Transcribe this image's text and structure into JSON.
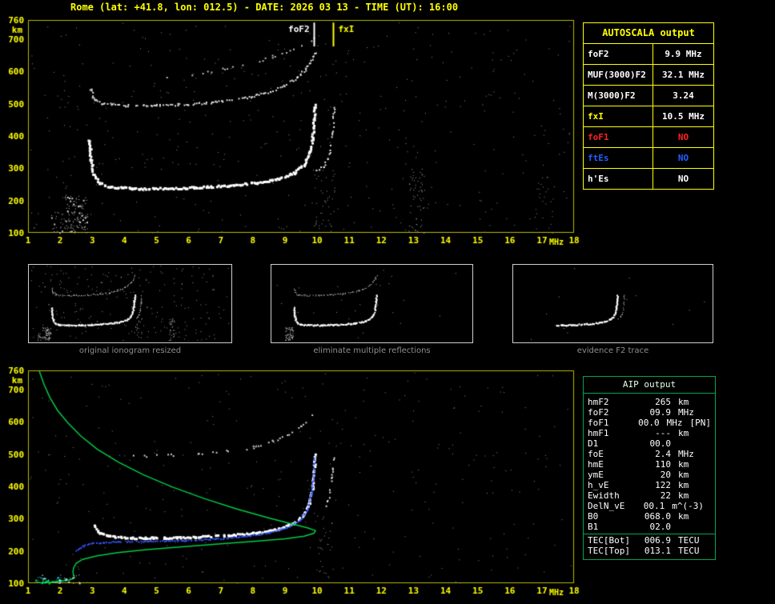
{
  "header": {
    "title": "Rome (lat: +41.8, lon: 012.5) - DATE: 2026 03 13 - TIME (UT): 16:00"
  },
  "colors": {
    "background": "#000000",
    "accent_yellow": "#ffff00",
    "aip_green": "#00a550",
    "status_no_red": "#ff2020",
    "status_no_blue": "#2060ff",
    "trace_white": "#ffffff",
    "calc_trace_blue": "#3355ff",
    "profile_green": "#00cc44"
  },
  "autoscala": {
    "title": "AUTOSCALA output",
    "rows": [
      {
        "label": "foF2",
        "value": "9.9 MHz",
        "label_color": "#ffffff",
        "value_color": "#ffffff"
      },
      {
        "label": "MUF(3000)F2",
        "value": "32.1 MHz",
        "label_color": "#ffffff",
        "value_color": "#ffffff"
      },
      {
        "label": "M(3000)F2",
        "value": "3.24",
        "label_color": "#ffffff",
        "value_color": "#ffffff"
      },
      {
        "label": "fxI",
        "value": "10.5 MHz",
        "label_color": "#ffff00",
        "value_color": "#ffffff"
      },
      {
        "label": "foF1",
        "value": "NO",
        "label_color": "#ff2020",
        "value_color": "#ff2020"
      },
      {
        "label": "ftEs",
        "value": "NO",
        "label_color": "#2060ff",
        "value_color": "#2060ff"
      },
      {
        "label": "h'Es",
        "value": "NO",
        "label_color": "#ffffff",
        "value_color": "#ffffff"
      }
    ]
  },
  "aip": {
    "title": "AIP output",
    "rows": [
      {
        "label": "hmF2",
        "value": "265",
        "unit": "km"
      },
      {
        "label": "foF2",
        "value": "09.9",
        "unit": "MHz"
      },
      {
        "label": "foF1",
        "value": "00.0",
        "unit": "MHz",
        "note": "[PN]"
      },
      {
        "label": "hmF1",
        "value": "---",
        "unit": "km"
      },
      {
        "label": "D1",
        "value": "00.0",
        "unit": ""
      },
      {
        "label": "foE",
        "value": "2.4",
        "unit": "MHz"
      },
      {
        "label": "hmE",
        "value": "110",
        "unit": "km"
      },
      {
        "label": "ymE",
        "value": "20",
        "unit": "km"
      },
      {
        "label": "h_vE",
        "value": "122",
        "unit": "km"
      },
      {
        "label": "Ewidth",
        "value": "22",
        "unit": "km"
      },
      {
        "label": "DelN_vE",
        "value": "00.1",
        "unit": "m^(-3)"
      },
      {
        "label": "B0",
        "value": "068.0",
        "unit": "km"
      },
      {
        "label": "B1",
        "value": "02.0",
        "unit": ""
      },
      {
        "label": "TEC[Bot]",
        "value": "006.9",
        "unit": "TECU"
      },
      {
        "label": "TEC[Top]",
        "value": "013.1",
        "unit": "TECU"
      }
    ]
  },
  "thumbnails": [
    {
      "caption": "original ionogram resized",
      "refs": [
        "f2_trace",
        "f2_cusp_x",
        "multiple_trace",
        "second_multiple",
        "e_region_scatter",
        "e_region_scatter2",
        "noise_floor",
        "noise_band_13",
        "noise_band_10"
      ]
    },
    {
      "caption": "eliminate multiple reflections",
      "refs": [
        "f2_trace",
        "multiple_trace",
        "e_region_scatter"
      ],
      "noise": 60
    },
    {
      "caption": "evidence F2 trace",
      "refs": [
        {
          "ref": "f2_trace",
          "clip": [
            4.6,
            10.2
          ]
        },
        "f2_cusp_x"
      ],
      "noise": 24
    }
  ],
  "chart_data": [
    {
      "id": "autoscala_ionogram",
      "type": "scatter",
      "title": "",
      "xlabel": "MHz",
      "ylabel": "km",
      "xlim": [
        1,
        18
      ],
      "ylim": [
        100,
        760
      ],
      "xticks": [
        1,
        2,
        3,
        4,
        5,
        6,
        7,
        8,
        9,
        10,
        11,
        12,
        13,
        14,
        15,
        16,
        17,
        18
      ],
      "yticks": [
        100,
        200,
        300,
        400,
        500,
        600,
        700,
        760
      ],
      "axis_color": "#ffff00",
      "frame_color": "#b8b800",
      "grid": false,
      "legend": "none",
      "series": [
        {
          "name": "f2_trace",
          "style": "dots",
          "color": "#ffffff",
          "size": 3,
          "spacing": 2,
          "density": 0.92,
          "jitter": 1.2,
          "points": [
            [
              2.88,
              392
            ],
            [
              2.93,
              330
            ],
            [
              3.02,
              284
            ],
            [
              3.18,
              258
            ],
            [
              3.5,
              246
            ],
            [
              4.2,
              240
            ],
            [
              5.2,
              240
            ],
            [
              6.2,
              243
            ],
            [
              7.2,
              249
            ],
            [
              8.1,
              258
            ],
            [
              8.8,
              270
            ],
            [
              9.25,
              288
            ],
            [
              9.55,
              313
            ],
            [
              9.73,
              348
            ],
            [
              9.83,
              398
            ],
            [
              9.88,
              452
            ],
            [
              9.91,
              500
            ]
          ]
        },
        {
          "name": "f2_cusp_x",
          "style": "dots",
          "color": "#e8e8e8",
          "size": 2,
          "spacing": 2.5,
          "density": 0.7,
          "jitter": 1,
          "points": [
            [
              9.98,
              295
            ],
            [
              10.18,
              308
            ],
            [
              10.32,
              332
            ],
            [
              10.42,
              372
            ],
            [
              10.48,
              432
            ],
            [
              10.51,
              497
            ]
          ]
        },
        {
          "name": "multiple_trace",
          "style": "dots",
          "color": "#dddddd",
          "size": 2,
          "spacing": 2.2,
          "density": 0.8,
          "jitter": 1.4,
          "points": [
            [
              2.92,
              556
            ],
            [
              3.02,
              518
            ],
            [
              3.25,
              502
            ],
            [
              4.0,
              496
            ],
            [
              5.0,
              497
            ],
            [
              6.0,
              501
            ],
            [
              7.0,
              509
            ],
            [
              7.8,
              521
            ],
            [
              8.45,
              538
            ],
            [
              8.95,
              558
            ],
            [
              9.35,
              582
            ],
            [
              9.65,
              612
            ],
            [
              9.85,
              645
            ],
            [
              9.98,
              668
            ]
          ]
        },
        {
          "name": "second_multiple",
          "style": "dots",
          "color": "#bbbbbb",
          "size": 2,
          "spacing": 3,
          "density": 0.3,
          "jitter": 2,
          "points": [
            [
              5.3,
              585
            ],
            [
              6.3,
              596
            ],
            [
              7.3,
              612
            ],
            [
              8.2,
              634
            ],
            [
              9.0,
              660
            ],
            [
              9.6,
              688
            ],
            [
              10.0,
              710
            ]
          ]
        },
        {
          "name": "e_region_scatter",
          "style": "speckle",
          "color": "#cccccc",
          "size": 2,
          "count": 110,
          "x": [
            2.15,
            2.85
          ],
          "y": [
            100,
            218
          ]
        },
        {
          "name": "e_region_scatter2",
          "style": "speckle",
          "color": "#aaaaaa",
          "size": 2,
          "count": 30,
          "x": [
            1.7,
            2.2
          ],
          "y": [
            100,
            165
          ]
        },
        {
          "name": "noise_floor",
          "style": "speckle",
          "color": "#909090",
          "size": 1,
          "count": 420,
          "x": [
            1.05,
            17.9
          ],
          "y": [
            100,
            755
          ]
        },
        {
          "name": "noise_band_13",
          "style": "speckle",
          "color": "#aaaaaa",
          "size": 1,
          "count": 60,
          "x": [
            12.85,
            13.35
          ],
          "y": [
            100,
            300
          ]
        },
        {
          "name": "noise_band_10",
          "style": "speckle",
          "color": "#999999",
          "size": 1,
          "count": 40,
          "x": [
            9.85,
            10.55
          ],
          "y": [
            100,
            300
          ]
        },
        {
          "name": "noise_band_17",
          "style": "speckle",
          "color": "#888888",
          "size": 1,
          "count": 22,
          "x": [
            16.8,
            17.4
          ],
          "y": [
            100,
            280
          ]
        }
      ],
      "markers": [
        {
          "label": "foF2",
          "x": 9.9,
          "color": "#ffffff",
          "label_side": "left",
          "h_from": 752,
          "h_to": 678
        },
        {
          "label": "fxI",
          "x": 10.5,
          "color": "#ffff00",
          "label_side": "right",
          "h_from": 752,
          "h_to": 678
        }
      ]
    },
    {
      "id": "aip_ionogram",
      "type": "scatter",
      "title": "",
      "xlabel": "MHz",
      "ylabel": "km",
      "xlim": [
        1,
        18
      ],
      "ylim": [
        100,
        760
      ],
      "xticks": [
        1,
        2,
        3,
        4,
        5,
        6,
        7,
        8,
        9,
        10,
        11,
        12,
        13,
        14,
        15,
        16,
        17,
        18
      ],
      "yticks": [
        100,
        200,
        300,
        400,
        500,
        600,
        700,
        760
      ],
      "axis_color": "#ffff00",
      "frame_color": "#b8b800",
      "grid": false,
      "legend": "none",
      "series": [
        {
          "name": "restored_trace",
          "style": "dots",
          "color": "#ffffff",
          "size": 3,
          "spacing": 2,
          "density": 0.9,
          "jitter": 1,
          "points": [
            [
              3.05,
              280
            ],
            [
              3.2,
              258
            ],
            [
              3.5,
              248
            ],
            [
              4.2,
              243
            ],
            [
              5.2,
              243
            ],
            [
              6.2,
              246
            ],
            [
              7.2,
              251
            ],
            [
              8.1,
              259
            ],
            [
              8.8,
              271
            ],
            [
              9.25,
              289
            ],
            [
              9.55,
              314
            ],
            [
              9.73,
              349
            ],
            [
              9.83,
              399
            ],
            [
              9.88,
              452
            ],
            [
              9.91,
              500
            ]
          ]
        },
        {
          "name": "xmode_cusp",
          "style": "dots",
          "color": "#dddddd",
          "size": 2,
          "spacing": 2.5,
          "density": 0.6,
          "jitter": 1,
          "points": [
            [
              10.2,
              330
            ],
            [
              10.35,
              365
            ],
            [
              10.44,
              420
            ],
            [
              10.5,
              492
            ]
          ]
        },
        {
          "name": "calc_trace_blue",
          "style": "dots",
          "color": "#3355ff",
          "size": 2,
          "spacing": 2.4,
          "density": 0.95,
          "jitter": 0.8,
          "points": [
            [
              2.5,
              203
            ],
            [
              2.7,
              217
            ],
            [
              3.0,
              226
            ],
            [
              3.8,
              231
            ],
            [
              4.8,
              232
            ],
            [
              5.8,
              234
            ],
            [
              6.8,
              239
            ],
            [
              7.7,
              246
            ],
            [
              8.5,
              258
            ],
            [
              9.05,
              275
            ],
            [
              9.45,
              298
            ],
            [
              9.68,
              330
            ],
            [
              9.8,
              378
            ],
            [
              9.87,
              432
            ],
            [
              9.9,
              488
            ]
          ]
        },
        {
          "name": "density_profile_green",
          "style": "line",
          "color": "#00cc44",
          "size": 1.5,
          "points": [
            [
              1.35,
              758
            ],
            [
              1.5,
              716
            ],
            [
              1.68,
              676
            ],
            [
              1.92,
              636
            ],
            [
              2.25,
              596
            ],
            [
              2.65,
              556
            ],
            [
              3.15,
              516
            ],
            [
              3.8,
              476
            ],
            [
              4.6,
              436
            ],
            [
              5.5,
              398
            ],
            [
              6.5,
              362
            ],
            [
              7.5,
              330
            ],
            [
              8.5,
              302
            ],
            [
              9.2,
              284
            ],
            [
              9.7,
              272
            ],
            [
              9.95,
              263
            ],
            [
              9.9,
              255
            ],
            [
              9.6,
              246
            ],
            [
              9.0,
              238
            ],
            [
              8.1,
              230
            ],
            [
              7.0,
              222
            ],
            [
              5.8,
              213
            ],
            [
              4.7,
              204
            ],
            [
              3.8,
              195
            ],
            [
              3.15,
              185
            ],
            [
              2.7,
              174
            ],
            [
              2.5,
              162
            ],
            [
              2.42,
              148
            ],
            [
              2.4,
              134
            ],
            [
              2.42,
              124
            ],
            [
              2.45,
              117
            ],
            [
              2.3,
              110
            ],
            [
              2.0,
              106
            ],
            [
              1.7,
              103
            ],
            [
              1.4,
              101
            ]
          ]
        },
        {
          "name": "multiple_remnant",
          "style": "dots",
          "color": "#cccccc",
          "size": 2,
          "spacing": 3,
          "density": 0.4,
          "jitter": 1.5,
          "points": [
            [
              4.3,
              497
            ],
            [
              5.3,
              498
            ],
            [
              6.3,
              503
            ],
            [
              7.2,
              511
            ],
            [
              8.0,
              524
            ],
            [
              8.6,
              542
            ],
            [
              9.1,
              563
            ],
            [
              9.5,
              590
            ],
            [
              9.8,
              620
            ]
          ]
        },
        {
          "name": "es_specks_cyan",
          "style": "speckle",
          "color": "#00eeee",
          "size": 2,
          "count": 28,
          "x": [
            1.25,
            2.25
          ],
          "y": [
            100,
            120
          ]
        },
        {
          "name": "es_specks_green",
          "style": "speckle",
          "color": "#00dd44",
          "size": 2,
          "count": 18,
          "x": [
            1.2,
            2.0
          ],
          "y": [
            100,
            112
          ]
        },
        {
          "name": "es_specks_white",
          "style": "speckle",
          "color": "#dddddd",
          "size": 2,
          "count": 24,
          "x": [
            1.4,
            2.6
          ],
          "y": [
            100,
            128
          ]
        },
        {
          "name": "noise_floor",
          "style": "speckle",
          "color": "#8a8a8a",
          "size": 1,
          "count": 300,
          "x": [
            1.05,
            17.9
          ],
          "y": [
            100,
            755
          ]
        },
        {
          "name": "noise_band",
          "style": "speckle",
          "color": "#999999",
          "size": 1,
          "count": 30,
          "x": [
            10.0,
            10.5
          ],
          "y": [
            100,
            320
          ]
        }
      ],
      "markers": []
    }
  ]
}
